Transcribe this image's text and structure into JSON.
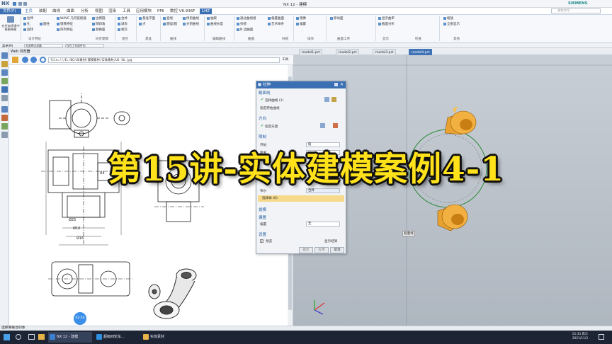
{
  "titlebar": {
    "app_badge": "NX",
    "title": "NX 12 - 建模",
    "brand": "SIEMENS",
    "search_placeholder": "查找命令"
  },
  "menubar": {
    "file_label": "文件(F)",
    "items": [
      "主页",
      "装配",
      "曲线",
      "曲面",
      "分析",
      "视图",
      "渲染",
      "工具",
      "应用模块",
      "PMI",
      "数控 V6.936F",
      "LHZ"
    ]
  },
  "ribbon": {
    "groups": [
      "设计特征",
      "同步建模",
      "组合",
      "基准",
      "曲线",
      "编辑曲线",
      "曲面",
      "扫掠",
      "操作",
      "曲面工序",
      "显示",
      "检查",
      "其他"
    ],
    "items": [
      "在任务环境中绘制草图",
      "拉伸",
      "孔",
      "旋转",
      "圆柱",
      "WAVE 几何链接器",
      "镜像特征",
      "阵列特征",
      "边倒圆",
      "倒斜角",
      "替换面",
      "合并",
      "减去",
      "相交",
      "基准平面",
      "点",
      "直线",
      "圆弧/圆",
      "修剪曲线",
      "分割曲线",
      "抽取",
      "曲线长度",
      "通过曲线组",
      "扫掠",
      "N 边曲面",
      "偏置曲面",
      "艺术样条",
      "镜像",
      "偏置",
      "移动面",
      "显示曲率",
      "截面分析",
      "缩放",
      "全部显示"
    ]
  },
  "selbar": {
    "menu_label": "菜单(M)",
    "filter": "无选择过滤器",
    "scope": "仅在工作部件内"
  },
  "browser": {
    "title": "Web 浏览器",
    "url": "file:///E:/BC/UG素材/建模素材/实体素材/UG-16.jpg",
    "tools_label": "工具",
    "view_label": "截面线"
  },
  "viewport": {
    "tabs": [
      "model1.prt",
      "model2.prt",
      "model3.prt",
      "model4.prt"
    ],
    "active_tab": "model4.prt",
    "section_label": "截面线"
  },
  "dialog": {
    "title": "拉伸",
    "section_label": "截面线",
    "select_curve": "选择曲线 (2)",
    "draw_section": "指定原始曲线",
    "direction_label": "方向",
    "specify_vector": "指定矢量",
    "limits_label": "限制",
    "start_label": "开始",
    "start_value": "值",
    "distance_label": "距离",
    "boolean_label": "布尔",
    "boolean_value": "合并",
    "select_body": "选择体 (0)",
    "draft_label": "拔模",
    "offset_label": "偏置",
    "offset_row": "偏置",
    "offset_value": "无",
    "settings_label": "设置",
    "preview_label": "预览",
    "show_result": "显示结果",
    "ok_label": "确定",
    "apply_label": "应用",
    "cancel_label": "取消"
  },
  "overlay": {
    "text": "第15讲-实体建模案例4-1"
  },
  "drawing": {
    "dims": [
      "Ø25",
      "Ø10",
      "R4",
      "Ø16"
    ]
  },
  "badge": {
    "time": "02:54"
  },
  "statusbar": {
    "text": "选择要联合的体"
  },
  "taskbar": {
    "apps": [
      {
        "label": "NX 12 - 建模",
        "color": "#3d7fd1"
      },
      {
        "label": "超级四轮车...",
        "color": "#2f8fe0"
      },
      {
        "label": "实体素材",
        "color": "#e8b44a"
      }
    ],
    "time": "15:33 周三",
    "date": "2021/11/3"
  },
  "colors": {
    "accent": "#3a6fb4",
    "overlay_text": "#ffe21a",
    "model_face": "#f0a020"
  }
}
